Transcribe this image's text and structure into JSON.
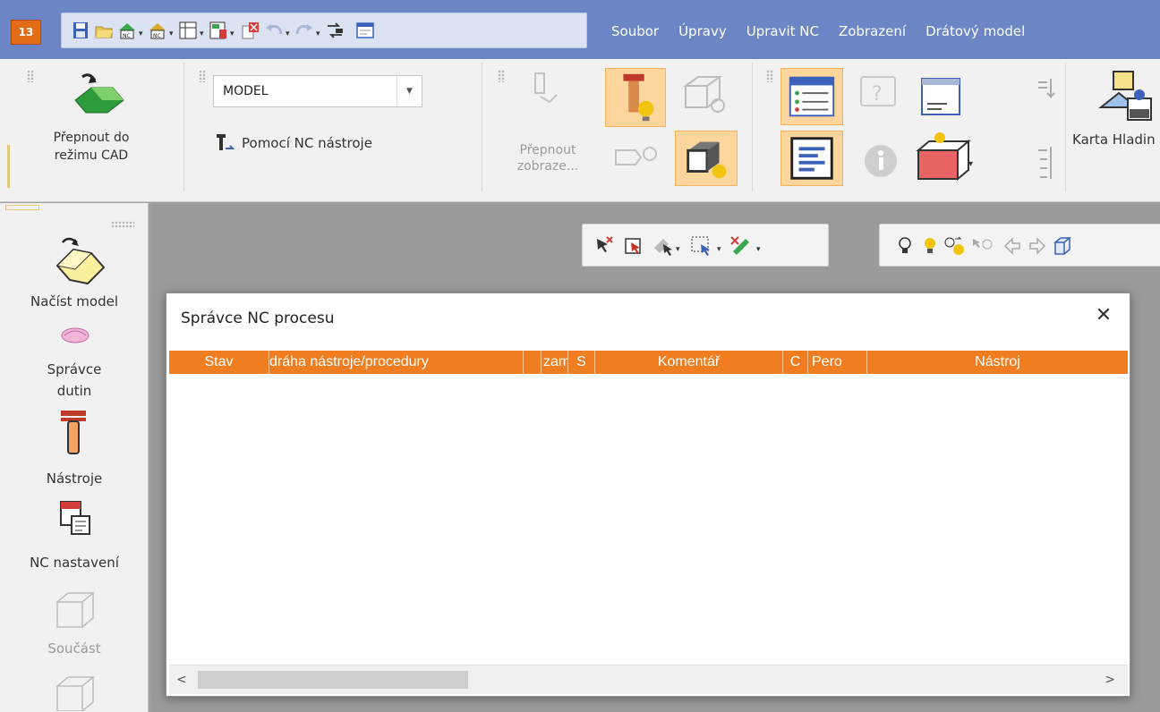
{
  "app": {
    "logo_text": "13",
    "brand_color": "#e36c17",
    "titlebar_color": "#6c86c5"
  },
  "quick_access": {
    "icons": [
      "save-icon",
      "open-folder-icon",
      "house-nc-icon",
      "dropdown-arrow",
      "house-cam-icon",
      "dropdown-arrow",
      "table-nc-icon",
      "dropdown-arrow",
      "calculator-nc-icon",
      "dropdown-arrow",
      "delete-copy-icon",
      "undo-icon",
      "dropdown-arrow",
      "redo-icon",
      "dropdown-arrow",
      "swap-icon",
      "window-icon"
    ]
  },
  "menu": {
    "items": [
      "Soubor",
      "Úpravy",
      "Upravit NC",
      "Zobrazení",
      "Drátový model"
    ]
  },
  "ribbon": {
    "switch_cad": {
      "line1": "Přepnout do",
      "line2": "režimu CAD",
      "icon": "switch-cad-icon"
    },
    "model_combo": {
      "value": "MODEL"
    },
    "nc_tool": {
      "label": "Pomocí NC nástroje",
      "icon": "nc-tool-small-icon"
    },
    "switch_view": {
      "line1": "Přepnout",
      "line2": "zobraze..."
    },
    "karta": {
      "label": "Karta Hladin"
    }
  },
  "sidebar": {
    "items": [
      {
        "label": "Načíst model",
        "icon": "load-model-icon",
        "enabled": true
      },
      {
        "label": "Správce dutin",
        "line1": "Správce",
        "line2": "dutin",
        "icon": "cavity-manager-icon",
        "enabled": true
      },
      {
        "label": "Nástroje",
        "icon": "tools-icon",
        "enabled": true
      },
      {
        "label": "NC nastavení",
        "icon": "nc-settings-icon",
        "enabled": true
      },
      {
        "label": "Součást",
        "icon": "part-icon",
        "enabled": false
      },
      {
        "label": "",
        "icon": "stock-icon",
        "enabled": false
      }
    ]
  },
  "dialog": {
    "title": "Správce NC procesu",
    "close_glyph": "✕",
    "header_color": "#f07d20",
    "columns": [
      "Stav",
      "dráha nástroje/procedury",
      "",
      "zam",
      "S",
      "Komentář",
      "C",
      "Pero",
      "Nástroj"
    ],
    "scroll_left": "<",
    "scroll_right": ">"
  }
}
